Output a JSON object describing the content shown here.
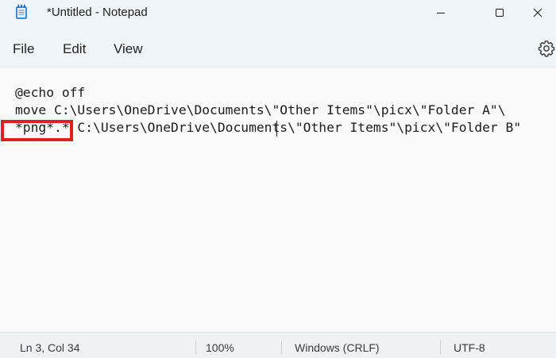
{
  "window": {
    "title": "*Untitled - Notepad",
    "icon": "notepad-icon",
    "controls": [
      "minimize-icon",
      "maximize-icon",
      "close-icon"
    ]
  },
  "menu": {
    "file": "File",
    "edit": "Edit",
    "view": "View",
    "settings_icon": "gear-icon"
  },
  "editor": {
    "lines": [
      "@echo off",
      "move C:\\Users\\OneDrive\\Documents\\\"Other Items\"\\picx\\\"Folder A\"\\",
      "*png*.* C:\\Users\\OneDrive\\Documents\\\"Other Items\"\\picx\\\"Folder B\""
    ],
    "highlight_color": "#e0201f"
  },
  "status": {
    "position": "Ln 3, Col 34",
    "zoom": "100%",
    "line_ending": "Windows (CRLF)",
    "encoding": "UTF-8"
  }
}
